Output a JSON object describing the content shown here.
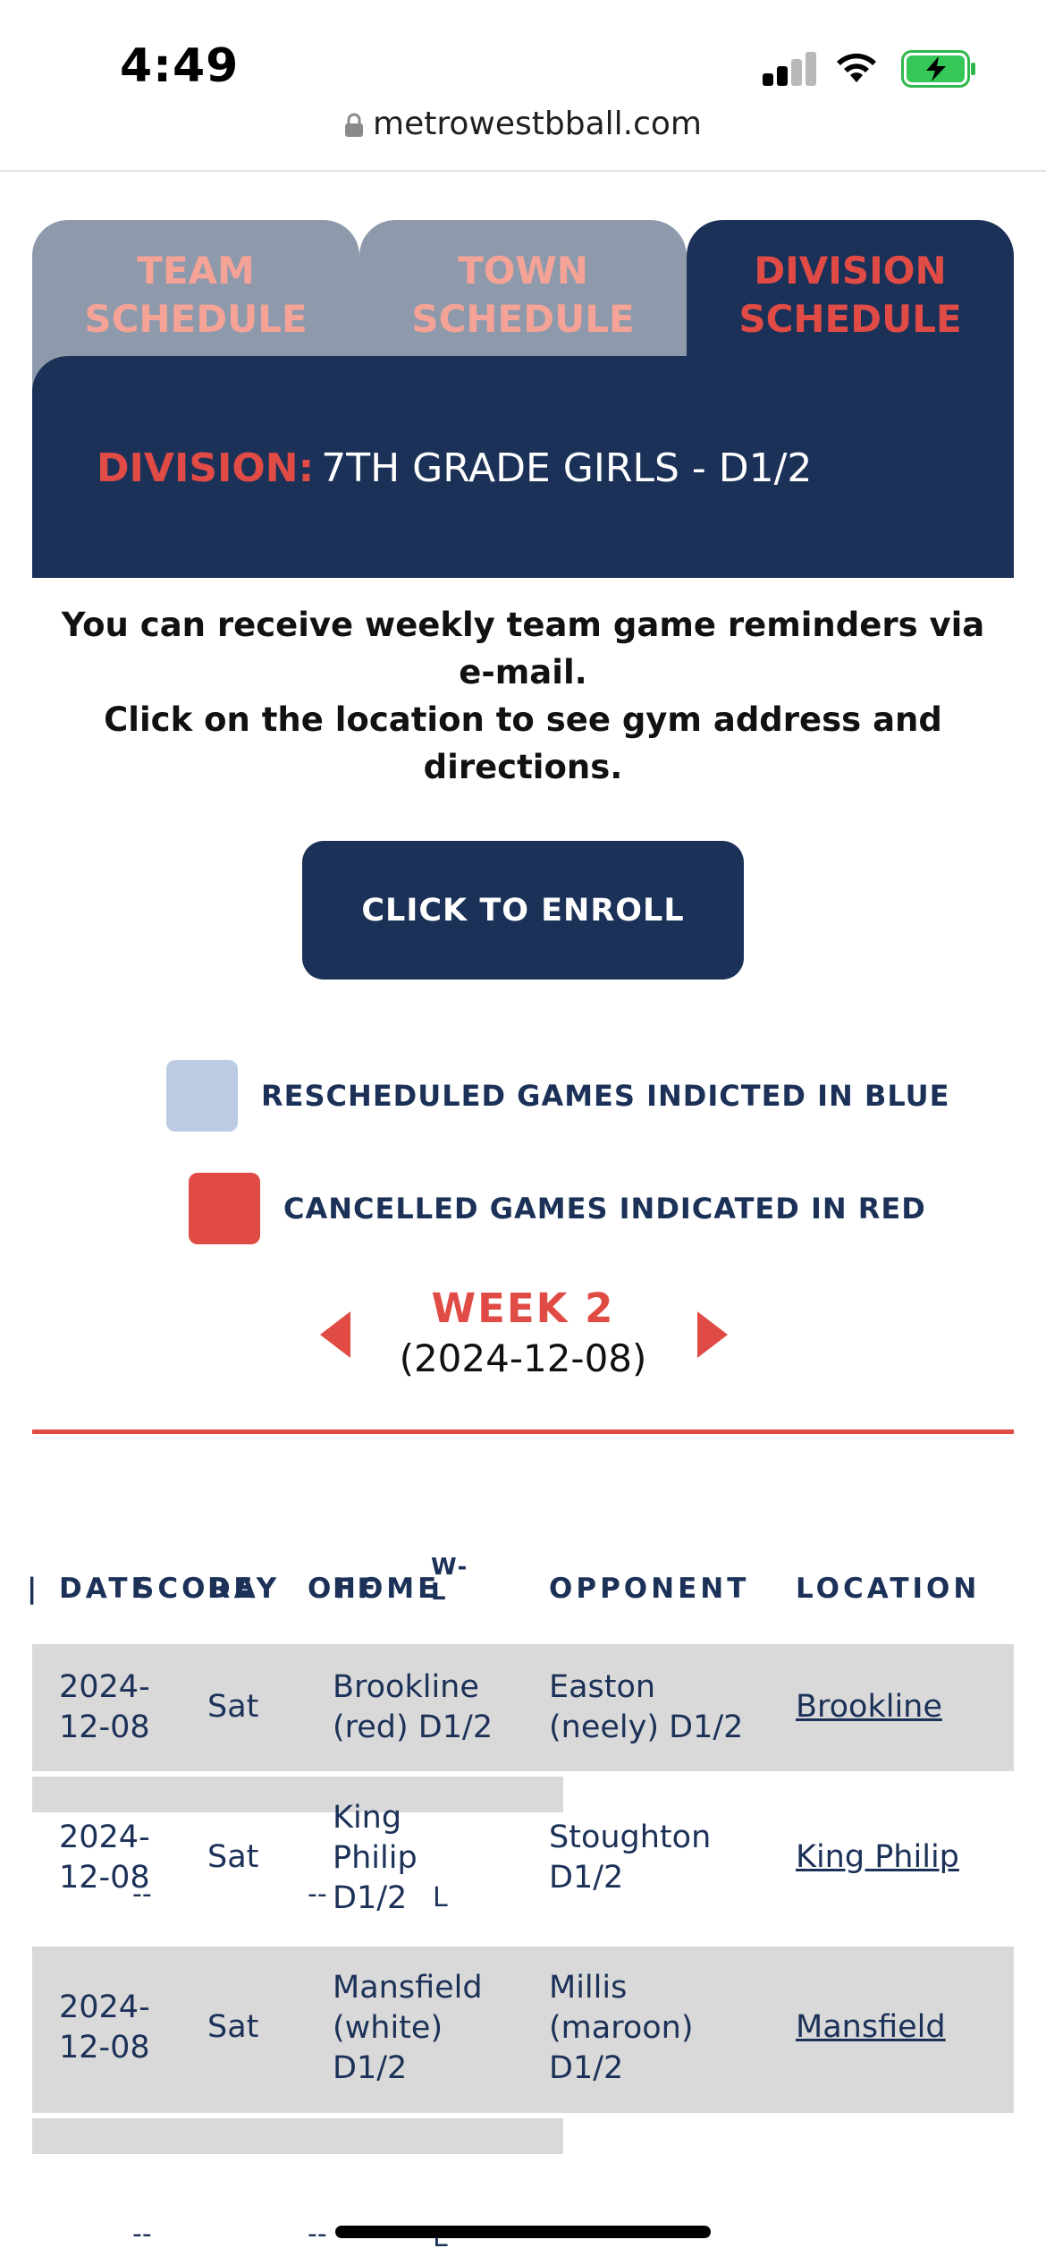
{
  "status_bar": {
    "time": "4:49",
    "url": "metrowestbball.com"
  },
  "tabs": [
    {
      "line1": "TEAM",
      "line2": "SCHEDULE",
      "active": false
    },
    {
      "line1": "TOWN",
      "line2": "SCHEDULE",
      "active": false
    },
    {
      "line1": "DIVISION",
      "line2": "SCHEDULE",
      "active": true
    }
  ],
  "division": {
    "label": "DIVISION:",
    "value": "7TH GRADE GIRLS - D1/2"
  },
  "info": {
    "line1": "You can receive weekly team game reminders via e-mail.",
    "line2": "Click on the location to see gym address and directions."
  },
  "enroll_button": "CLICK TO ENROLL",
  "legend": [
    {
      "text": "RESCHEDULED GAMES INDICTED IN BLUE",
      "color": "#bccbe3"
    },
    {
      "text": "CANCELLED GAMES INDICATED IN RED",
      "color": "#e04b45"
    }
  ],
  "week": {
    "title": "WEEK 2",
    "date": "(2024-12-08)"
  },
  "table": {
    "headers": {
      "date": "DATE",
      "score": "SCORE",
      "day": "DAY",
      "home": "HOME",
      "off": "OFF",
      "wl": "W-L",
      "opponent": "OPPONENT",
      "location": "LOCATION"
    },
    "rows": [
      {
        "date": "2024-12-08",
        "day": "Sat",
        "home": "Brookline (red) D1/2",
        "opponent": "Easton (neely) D1/2",
        "location": "Brookline"
      },
      {
        "date": "2024-12-08",
        "day": "Sat",
        "home": "King Philip D1/2",
        "opponent": "Stoughton D1/2",
        "location": "King Philip"
      },
      {
        "date": "2024-12-08",
        "day": "Sat",
        "home": "Mansfield (white) D1/2",
        "opponent": "Millis (maroon) D1/2",
        "location": "Mansfield"
      }
    ],
    "ghost": {
      "dash": "--",
      "result": "L"
    }
  },
  "colors": {
    "navy": "#1c3158",
    "red": "#e04b45",
    "tab_gray": "#8e9aab",
    "row_gray": "#d9d9d9"
  }
}
